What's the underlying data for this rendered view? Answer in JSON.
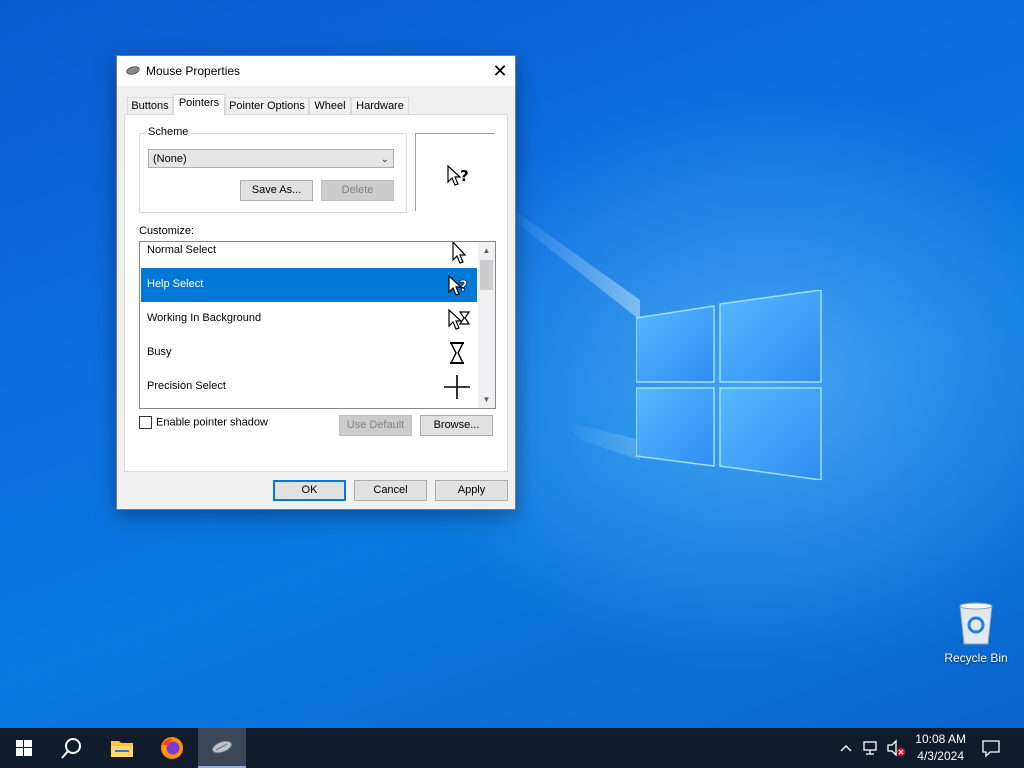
{
  "window": {
    "title": "Mouse Properties",
    "close_glyph": "✕"
  },
  "tabs": [
    "Buttons",
    "Pointers",
    "Pointer Options",
    "Wheel",
    "Hardware"
  ],
  "active_tab": "Pointers",
  "scheme": {
    "group_label": "Scheme",
    "selected": "(None)",
    "save_as_label": "Save As...",
    "delete_label": "Delete"
  },
  "customize": {
    "label": "Customize:",
    "items": [
      {
        "label": "Normal Select",
        "icon": "arrow-cursor-icon"
      },
      {
        "label": "Help Select",
        "icon": "help-cursor-icon",
        "selected": true
      },
      {
        "label": "Working In Background",
        "icon": "working-cursor-icon"
      },
      {
        "label": "Busy",
        "icon": "hourglass-cursor-icon"
      },
      {
        "label": "Precision Select",
        "icon": "crosshair-cursor-icon"
      }
    ]
  },
  "shadow_checkbox": {
    "label": "Enable pointer shadow",
    "checked": false
  },
  "use_default_label": "Use Default",
  "browse_label": "Browse...",
  "footer": {
    "ok": "OK",
    "cancel": "Cancel",
    "apply": "Apply"
  },
  "desktop": {
    "recycle_bin_label": "Recycle Bin"
  },
  "taskbar": {
    "items": [
      "start-icon",
      "search-icon",
      "file-explorer-icon",
      "firefox-icon",
      "mouse-properties-icon"
    ],
    "time": "10:08 AM",
    "date": "4/3/2024"
  },
  "colors": {
    "accent": "#0078d7",
    "taskbar": "#101c2c",
    "desktop": "#0b6ddf"
  }
}
